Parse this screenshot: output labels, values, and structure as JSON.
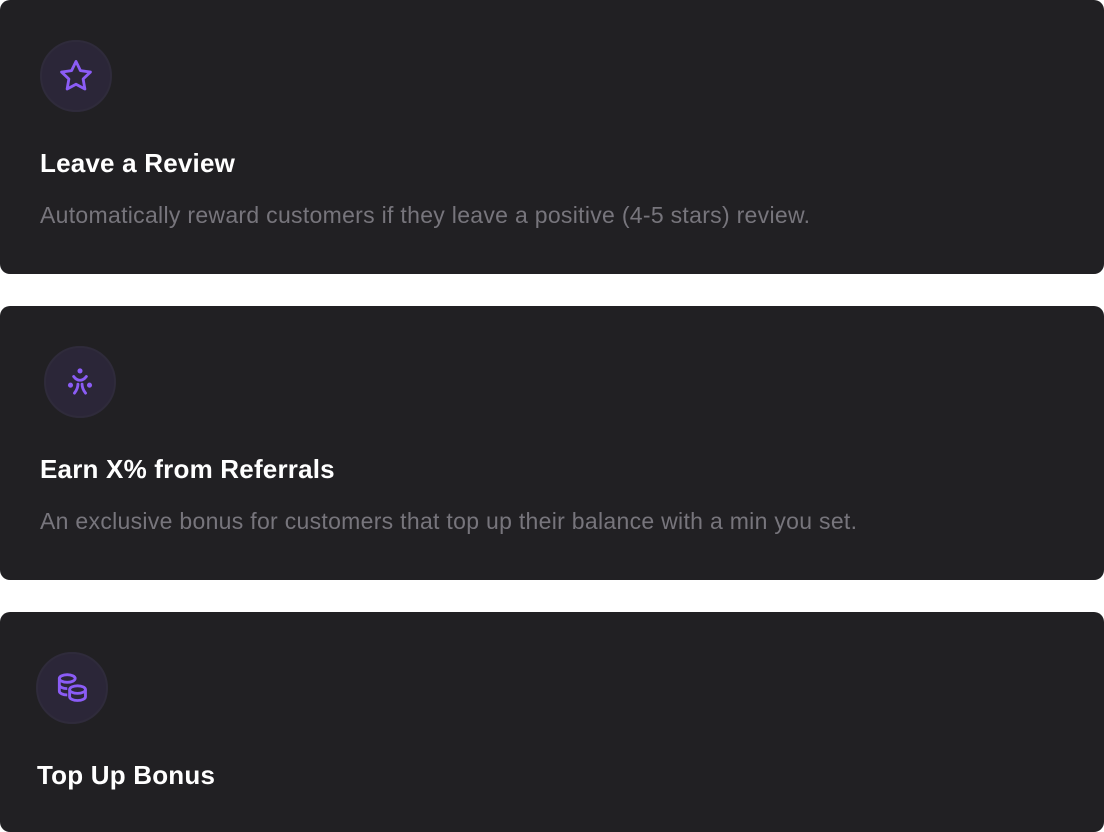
{
  "accent_color": "#8b5cf6",
  "cards": [
    {
      "icon": "star-icon",
      "title": "Leave a Review",
      "description": "Automatically reward customers if they leave a positive (4-5 stars) review."
    },
    {
      "icon": "referral-people-icon",
      "title": "Earn X% from Referrals",
      "description": "An exclusive bonus for customers that top up their balance with a min you set."
    },
    {
      "icon": "coins-icon",
      "title": "Top Up Bonus",
      "description": ""
    }
  ]
}
